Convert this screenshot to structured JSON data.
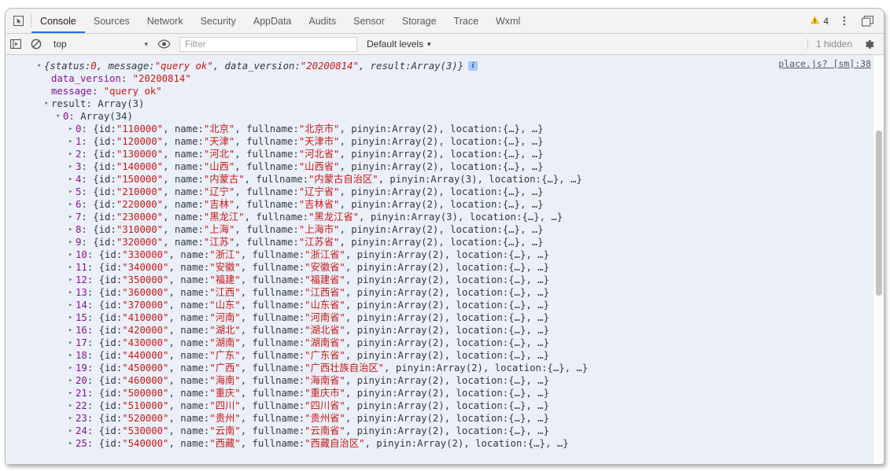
{
  "window": {
    "inspect_icon": "inspect-element-icon"
  },
  "tabstrip": {
    "tabs": [
      {
        "label": "Console",
        "active": true
      },
      {
        "label": "Sources",
        "active": false
      },
      {
        "label": "Network",
        "active": false
      },
      {
        "label": "Security",
        "active": false
      },
      {
        "label": "AppData",
        "active": false
      },
      {
        "label": "Audits",
        "active": false
      },
      {
        "label": "Sensor",
        "active": false
      },
      {
        "label": "Storage",
        "active": false
      },
      {
        "label": "Trace",
        "active": false
      },
      {
        "label": "Wxml",
        "active": false
      }
    ],
    "warning_count": "4",
    "warning_icon": "warning-triangle-icon",
    "kebab_icon": "more-options-icon",
    "dock_icon": "dock-side-icon",
    "accent_color": "#1a73e8",
    "warning_color": "#f5c518"
  },
  "console_toolbar": {
    "sidebar_toggle_icon": "console-sidebar-toggle-icon",
    "clear_icon": "clear-console-icon",
    "context_value": "top",
    "eye_icon": "create-live-expression-icon",
    "filter_placeholder": "Filter",
    "filter_value": "",
    "levels_label": "Default levels",
    "hidden_label": "1 hidden",
    "settings_icon": "settings-gear-icon"
  },
  "console": {
    "source_link": "place.js? [sm]:38",
    "summary": {
      "prefix": "{status: ",
      "status_value": "0",
      "mid1": ", message: ",
      "message_value": "\"query ok\"",
      "mid2": ", data_version: ",
      "data_version_value": "\"20200814\"",
      "mid3": ", result: ",
      "result_value": "Array(3)",
      "suffix": "}",
      "badge": "i"
    },
    "props": [
      {
        "key": "data_version",
        "value": "\"20200814\""
      },
      {
        "key": "message",
        "value": "\"query ok\""
      }
    ],
    "result_label": "result:",
    "result_value": "Array(3)",
    "array0_label": "0:",
    "array0_value": "Array(34)",
    "rows": [
      {
        "index": "0",
        "id": "\"110000\"",
        "name": "\"北京\"",
        "fullname": "\"北京市\"",
        "pinyin": "Array(2)"
      },
      {
        "index": "1",
        "id": "\"120000\"",
        "name": "\"天津\"",
        "fullname": "\"天津市\"",
        "pinyin": "Array(2)"
      },
      {
        "index": "2",
        "id": "\"130000\"",
        "name": "\"河北\"",
        "fullname": "\"河北省\"",
        "pinyin": "Array(2)"
      },
      {
        "index": "3",
        "id": "\"140000\"",
        "name": "\"山西\"",
        "fullname": "\"山西省\"",
        "pinyin": "Array(2)"
      },
      {
        "index": "4",
        "id": "\"150000\"",
        "name": "\"内蒙古\"",
        "fullname": "\"内蒙古自治区\"",
        "pinyin": "Array(3)"
      },
      {
        "index": "5",
        "id": "\"210000\"",
        "name": "\"辽宁\"",
        "fullname": "\"辽宁省\"",
        "pinyin": "Array(2)"
      },
      {
        "index": "6",
        "id": "\"220000\"",
        "name": "\"吉林\"",
        "fullname": "\"吉林省\"",
        "pinyin": "Array(2)"
      },
      {
        "index": "7",
        "id": "\"230000\"",
        "name": "\"黑龙江\"",
        "fullname": "\"黑龙江省\"",
        "pinyin": "Array(3)"
      },
      {
        "index": "8",
        "id": "\"310000\"",
        "name": "\"上海\"",
        "fullname": "\"上海市\"",
        "pinyin": "Array(2)"
      },
      {
        "index": "9",
        "id": "\"320000\"",
        "name": "\"江苏\"",
        "fullname": "\"江苏省\"",
        "pinyin": "Array(2)"
      },
      {
        "index": "10",
        "id": "\"330000\"",
        "name": "\"浙江\"",
        "fullname": "\"浙江省\"",
        "pinyin": "Array(2)"
      },
      {
        "index": "11",
        "id": "\"340000\"",
        "name": "\"安徽\"",
        "fullname": "\"安徽省\"",
        "pinyin": "Array(2)"
      },
      {
        "index": "12",
        "id": "\"350000\"",
        "name": "\"福建\"",
        "fullname": "\"福建省\"",
        "pinyin": "Array(2)"
      },
      {
        "index": "13",
        "id": "\"360000\"",
        "name": "\"江西\"",
        "fullname": "\"江西省\"",
        "pinyin": "Array(2)"
      },
      {
        "index": "14",
        "id": "\"370000\"",
        "name": "\"山东\"",
        "fullname": "\"山东省\"",
        "pinyin": "Array(2)"
      },
      {
        "index": "15",
        "id": "\"410000\"",
        "name": "\"河南\"",
        "fullname": "\"河南省\"",
        "pinyin": "Array(2)"
      },
      {
        "index": "16",
        "id": "\"420000\"",
        "name": "\"湖北\"",
        "fullname": "\"湖北省\"",
        "pinyin": "Array(2)"
      },
      {
        "index": "17",
        "id": "\"430000\"",
        "name": "\"湖南\"",
        "fullname": "\"湖南省\"",
        "pinyin": "Array(2)"
      },
      {
        "index": "18",
        "id": "\"440000\"",
        "name": "\"广东\"",
        "fullname": "\"广东省\"",
        "pinyin": "Array(2)"
      },
      {
        "index": "19",
        "id": "\"450000\"",
        "name": "\"广西\"",
        "fullname": "\"广西壮族自治区\"",
        "pinyin": "Array(2)"
      },
      {
        "index": "20",
        "id": "\"460000\"",
        "name": "\"海南\"",
        "fullname": "\"海南省\"",
        "pinyin": "Array(2)"
      },
      {
        "index": "21",
        "id": "\"500000\"",
        "name": "\"重庆\"",
        "fullname": "\"重庆市\"",
        "pinyin": "Array(2)"
      },
      {
        "index": "22",
        "id": "\"510000\"",
        "name": "\"四川\"",
        "fullname": "\"四川省\"",
        "pinyin": "Array(2)"
      },
      {
        "index": "23",
        "id": "\"520000\"",
        "name": "\"贵州\"",
        "fullname": "\"贵州省\"",
        "pinyin": "Array(2)"
      },
      {
        "index": "24",
        "id": "\"530000\"",
        "name": "\"云南\"",
        "fullname": "\"云南省\"",
        "pinyin": "Array(2)"
      },
      {
        "index": "25",
        "id": "\"540000\"",
        "name": "\"西藏\"",
        "fullname": "\"西藏自治区\"",
        "pinyin": "Array(2)"
      }
    ],
    "row_tokens": {
      "open_brace": "{id: ",
      "name_key": ", name: ",
      "fullname_key": ", fullname: ",
      "pinyin_key": ", pinyin: ",
      "location_key": ", location: ",
      "location_value": "{…}",
      "tail": ", …}"
    },
    "colors": {
      "string": "#c41a16",
      "property": "#881391",
      "text": "#303942",
      "message_bg": "#eaeff8"
    }
  }
}
